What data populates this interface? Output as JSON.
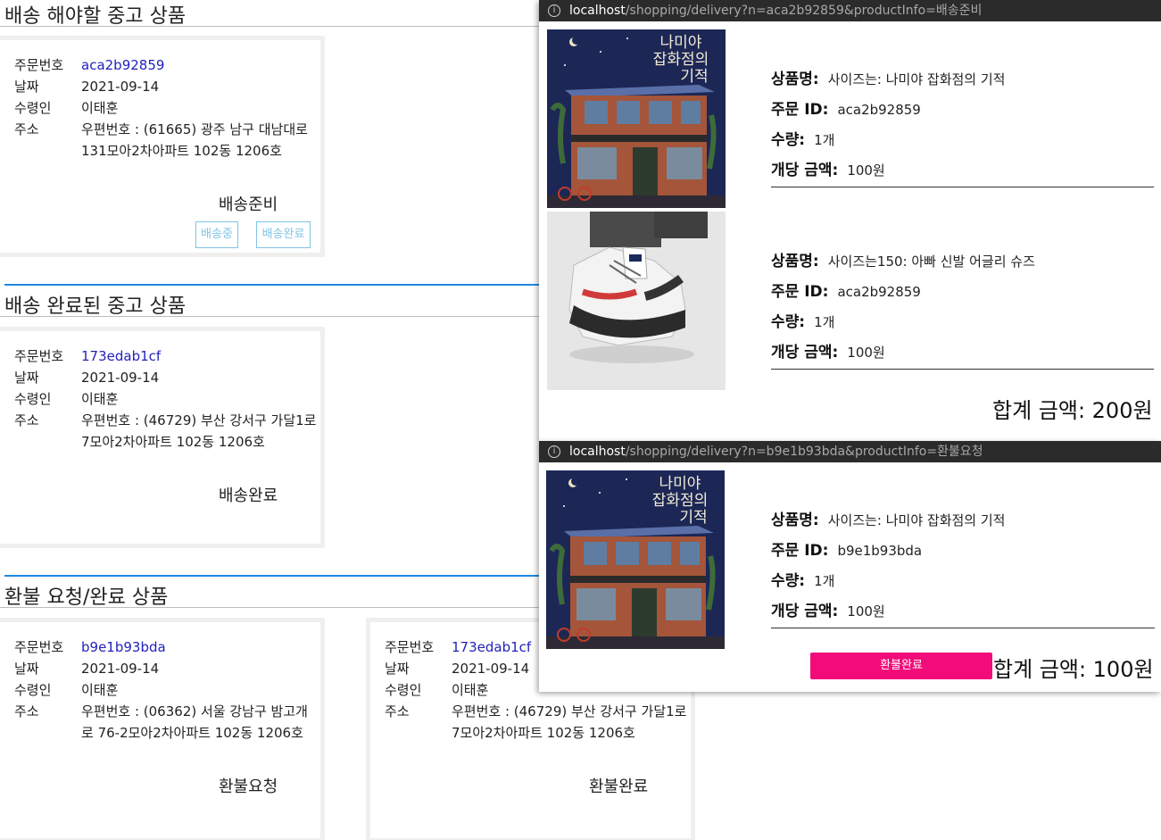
{
  "sections": {
    "ready": {
      "title": "배송 해야할 중고 상품"
    },
    "done": {
      "title": "배송 완료된 중고 상품"
    },
    "refund": {
      "title": "환불 요청/완료 상품"
    }
  },
  "labels": {
    "order_no": "주문번호",
    "date": "날짜",
    "recipient": "수령인",
    "address": "주소"
  },
  "cards": [
    {
      "order_no": "aca2b92859",
      "date": "2021-09-14",
      "recipient": "이태훈",
      "addr1": "우편번호 : (61665) 광주 남구 대남대로",
      "addr2": "131모아2차아파트 102동 1206호",
      "status": "배송준비",
      "btn1": "배송중",
      "btn2": "배송완료"
    },
    {
      "order_no": "173edab1cf",
      "date": "2021-09-14",
      "recipient": "이태훈",
      "addr1": "우편번호 : (46729) 부산 강서구 가달1로",
      "addr2": "7모아2차아파트 102동 1206호",
      "status": "배송완료"
    },
    {
      "order_no": "b9e1b93bda",
      "date": "2021-09-14",
      "recipient": "이태훈",
      "addr1": "우편번호 : (06362) 서울 강남구 밤고개",
      "addr2": "로 76-2모아2차아파트 102동 1206호",
      "status": "환불요청"
    },
    {
      "order_no": "173edab1cf",
      "date": "2021-09-14",
      "recipient": "이태훈",
      "addr1": "우편번호 : (46729) 부산 강서구 가달1로",
      "addr2": "7모아2차아파트 102동 1206호",
      "status": "환불완료"
    }
  ],
  "popup_labels": {
    "name": "상품명:",
    "order_id": "주문 ID:",
    "qty": "수량:",
    "unit_price": "개당 금액:"
  },
  "popup1": {
    "url_host": "localhost",
    "url_path": "/shopping/delivery?n=aca2b92859&productInfo=배송준비",
    "items": [
      {
        "name": "사이즈는: 나미야 잡화점의 기적",
        "order_id": "aca2b92859",
        "qty": "1개",
        "unit_price": "100원",
        "image": "book-cover"
      },
      {
        "name": "사이즈는150: 아빠 신발 어글리 슈즈",
        "order_id": "aca2b92859",
        "qty": "1개",
        "unit_price": "100원",
        "image": "sneaker-photo"
      }
    ],
    "total": "합계 금액: 200원"
  },
  "popup2": {
    "url_host": "localhost",
    "url_path": "/shopping/delivery?n=b9e1b93bda&productInfo=환불요청",
    "items": [
      {
        "name": "사이즈는: 나미야 잡화점의 기적",
        "order_id": "b9e1b93bda",
        "qty": "1개",
        "unit_price": "100원",
        "image": "book-cover"
      }
    ],
    "button": "환불완료",
    "total": "합계 금액: 100원"
  },
  "book_cover": {
    "title_line1": "나미야",
    "title_line2": "잡화점의",
    "title_line3": "기적"
  },
  "colors": {
    "accent_blue": "#1e88e5",
    "link": "#2222bb",
    "outline_button": "#7fc4e6",
    "refund_button": "#f10c7a",
    "urlbar": "#2b2b2b"
  }
}
